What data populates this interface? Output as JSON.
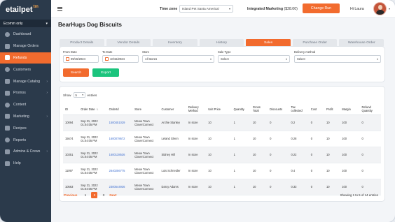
{
  "app": {
    "logo_text": "etailpet",
    "logo_accent": "tm"
  },
  "sidebar": {
    "client_select": "Ecomm only",
    "items": [
      {
        "label": "Dashboard",
        "icon": "dashboard-icon",
        "active": false,
        "has_children": false
      },
      {
        "label": "Manage Orders",
        "icon": "orders-icon",
        "active": false,
        "has_children": false
      },
      {
        "label": "Refunds",
        "icon": "refunds-icon",
        "active": true,
        "has_children": false
      },
      {
        "label": "Customers",
        "icon": "customers-icon",
        "active": false,
        "has_children": false
      },
      {
        "label": "Manage Catalog",
        "icon": "catalog-icon",
        "active": false,
        "has_children": true
      },
      {
        "label": "Promos",
        "icon": "promos-icon",
        "active": false,
        "has_children": true
      },
      {
        "label": "Content",
        "icon": "content-icon",
        "active": false,
        "has_children": false
      },
      {
        "label": "Marketing",
        "icon": "marketing-icon",
        "active": false,
        "has_children": true
      },
      {
        "label": "Recipes",
        "icon": "recipes-icon",
        "active": false,
        "has_children": false
      },
      {
        "label": "Reports",
        "icon": "reports-icon",
        "active": false,
        "has_children": false
      },
      {
        "label": "Admins & Crews",
        "icon": "admins-icon",
        "active": false,
        "has_children": true
      },
      {
        "label": "Help",
        "icon": "help-icon",
        "active": false,
        "has_children": false
      }
    ]
  },
  "topbar": {
    "timezone_label": "Time zone",
    "timezone_value": "Island Pet Santa America/",
    "marketing_label": "Integrated Marketing",
    "marketing_value": "($28.00)",
    "change_run_label": "Change Run",
    "greeting": "Hi Laura"
  },
  "page": {
    "title": "BearHugs Dog Biscuits",
    "tabs": [
      "Product Details",
      "Vendor Details",
      "Inventory",
      "History",
      "Sales",
      "Purchase Order",
      "Warehouse Order"
    ],
    "active_tab": "Sales"
  },
  "filters": {
    "from_label": "From Date",
    "from_value": "09/15/2024",
    "to_label": "To Date",
    "to_value": "10/15/2024",
    "store_label": "Store",
    "store_value": "All stores",
    "sale_type_label": "Sale Type",
    "sale_type_value": "Select",
    "delivery_label": "Delivery method",
    "delivery_value": "Select",
    "search_label": "Search",
    "export_label": "Export"
  },
  "table": {
    "show_prefix": "Show",
    "show_value": "5",
    "show_suffix": "entries",
    "columns": [
      "ID",
      "Order Date",
      "OrderId",
      "Store",
      "Customer",
      "Delivery Method",
      "Unit Price",
      "Quantity",
      "Gross Total",
      "Discounts",
      "Tax collected",
      "Cost",
      "Profit",
      "Margin",
      "Refund Quantity"
    ],
    "rows": [
      [
        "10094",
        "Sep 21, 2022 01:04:05 PM",
        "1500451029",
        "Meow Town CloverConnect",
        "Archie Stanley",
        "In store",
        "10",
        "1",
        "10",
        "0",
        "0.2",
        "0",
        "10",
        "100",
        "0"
      ],
      [
        "15674",
        "Sep 21, 2022 01:04:05 PM",
        "1600078672",
        "Meow Town CloverConnect",
        "Leland Glenn",
        "In store",
        "10",
        "1",
        "10",
        "0",
        "0.28",
        "0",
        "10",
        "100",
        "0"
      ],
      [
        "10351",
        "Sep 21, 2022 01:04:05 PM",
        "1600138536",
        "Meow Town CloverConnect",
        "Sidney Hill",
        "In store",
        "10",
        "1",
        "10",
        "0",
        "0.22",
        "0",
        "10",
        "100",
        "0"
      ],
      [
        "11097",
        "Sep 21, 2022 01:04:05 PM",
        "2640256775",
        "Meow Town CloverConnect",
        "Luis Schneider",
        "In store",
        "10",
        "1",
        "10",
        "0",
        "0.4",
        "0",
        "10",
        "100",
        "0"
      ],
      [
        "10563",
        "Sep 21, 2022 01:04:05 PM",
        "2300544936",
        "Meow Town CloverConnect",
        "Darcy Adams",
        "In store",
        "10",
        "1",
        "10",
        "0",
        "0.33",
        "0",
        "10",
        "100",
        "0"
      ]
    ],
    "pagination": {
      "prev": "Previous",
      "pages": [
        "1",
        "2",
        "3"
      ],
      "current": "2",
      "next": "Next",
      "summary": "Showing 1 to 5 of 14 entries"
    }
  },
  "colors": {
    "accent": "#f26b2e",
    "export": "#1bc47d",
    "sidebar": "#2b3a4b",
    "link": "#3e6fd0"
  }
}
